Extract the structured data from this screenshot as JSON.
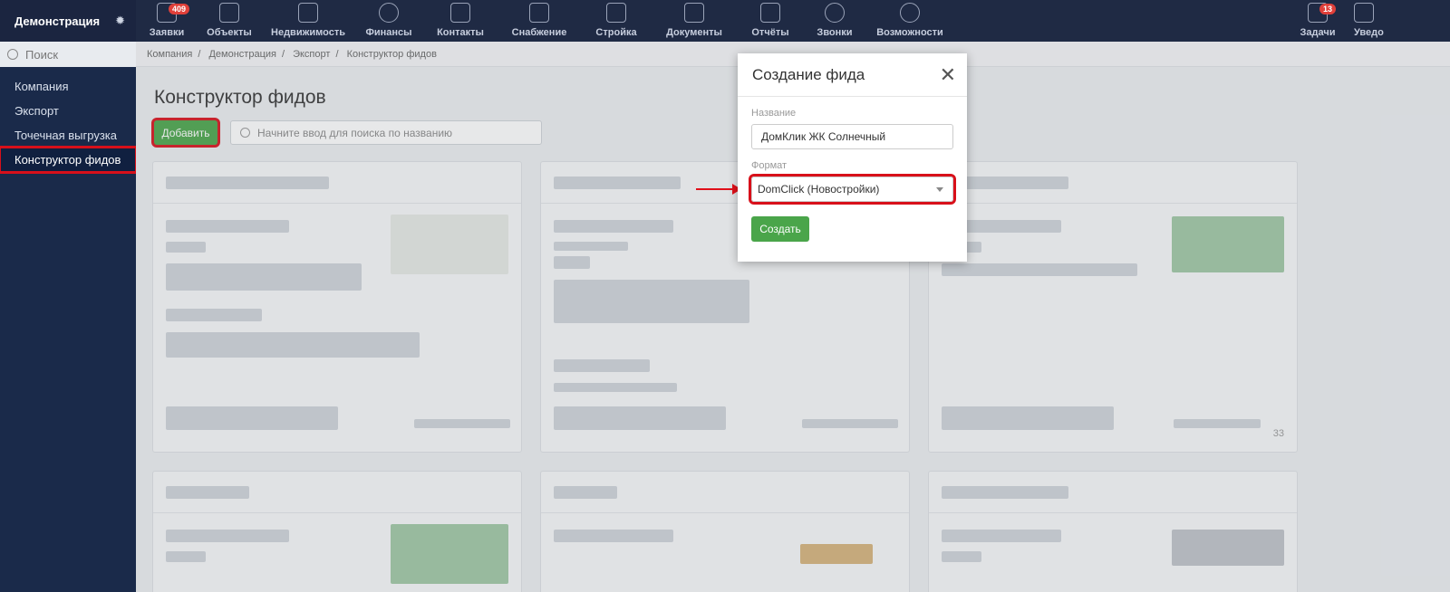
{
  "brand": {
    "name": "Демонстрация"
  },
  "nav": [
    {
      "label": "Заявки",
      "icon": "requests-icon",
      "badge": "409"
    },
    {
      "label": "Объекты",
      "icon": "objects-icon"
    },
    {
      "label": "Недвижимость",
      "icon": "buildings-icon"
    },
    {
      "label": "Финансы",
      "icon": "ruble-icon"
    },
    {
      "label": "Контакты",
      "icon": "contacts-icon"
    },
    {
      "label": "Снабжение",
      "icon": "truck-icon"
    },
    {
      "label": "Стройка",
      "icon": "construction-icon"
    },
    {
      "label": "Документы",
      "icon": "document-icon"
    },
    {
      "label": "Отчёты",
      "icon": "report-icon"
    },
    {
      "label": "Звонки",
      "icon": "phone-icon"
    },
    {
      "label": "Возможности",
      "icon": "gear-icon"
    },
    {
      "label": "Задачи",
      "icon": "calendar-icon",
      "badge": "13"
    },
    {
      "label": "Уведо",
      "icon": "bell-icon"
    }
  ],
  "sidebar": {
    "search_placeholder": "Поиск",
    "items": [
      {
        "label": "Компания"
      },
      {
        "label": "Экспорт"
      },
      {
        "label": "Точечная выгрузка"
      },
      {
        "label": "Конструктор фидов",
        "active": true
      }
    ]
  },
  "breadcrumb": [
    "Компания",
    "Демонстрация",
    "Экспорт",
    "Конструктор фидов"
  ],
  "page": {
    "title": "Конструктор фидов",
    "add_label": "Добавить",
    "search_placeholder": "Начните ввод для поиска по названию"
  },
  "cards": {
    "number_label": "33"
  },
  "modal": {
    "title": "Создание фида",
    "name_label": "Название",
    "name_value": "ДомКлик ЖК Солнечный",
    "format_label": "Формат",
    "format_value": "DomClick (Новостройки)",
    "create_label": "Создать"
  },
  "colors": {
    "accent_green": "#4aa54a",
    "highlight_red": "#d8101a",
    "nav_bg": "#1f2a44"
  }
}
